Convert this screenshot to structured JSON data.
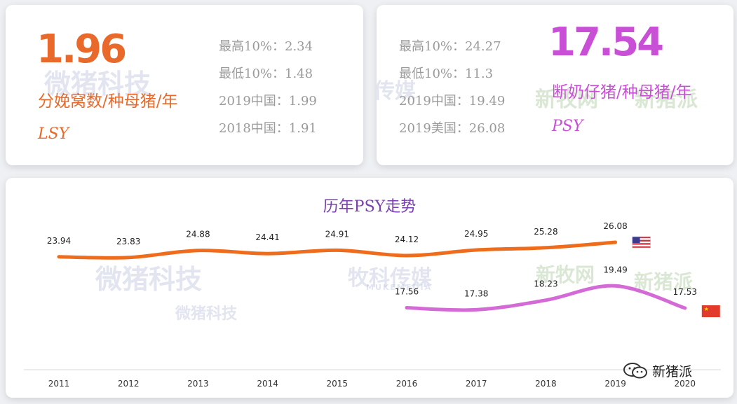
{
  "lsy_card": {
    "value": "1.96",
    "unit": "分娩窝数/种母猪/年",
    "abbr": "LSY",
    "stats": [
      "最高10%：2.34",
      "最低10%：1.48",
      "2019中国：1.99",
      "2018中国：1.91"
    ]
  },
  "psy_card": {
    "value": "17.54",
    "unit": "断奶仔猪/种母猪/年",
    "abbr": "PSY",
    "stats": [
      "最高10%：24.27",
      "最低10%：11.3",
      "2019中国：19.49",
      "2019美国：26.08"
    ]
  },
  "watermarks": {
    "weizhu": "微猪科技",
    "muke": "牧科传媒",
    "muke_en": "MUKEMEDIA",
    "xinmu": "新牧网",
    "xinzhu": "新猪派"
  },
  "brand": {
    "name": "新猪派"
  },
  "colors": {
    "lsy": "#e8692a",
    "psy": "#c94fd6",
    "title": "#7a3fb0"
  },
  "chart_data": {
    "type": "line",
    "title": "历年PSY走势",
    "x": [
      "2011",
      "2012",
      "2013",
      "2014",
      "2015",
      "2016",
      "2017",
      "2018",
      "2019",
      "2020"
    ],
    "series": [
      {
        "values": [
          23.94,
          23.83,
          24.88,
          24.41,
          24.91,
          24.12,
          24.95,
          25.28,
          26.08,
          null
        ],
        "color": "#ef6c1d",
        "flag": "us-flag"
      },
      {
        "values": [
          null,
          null,
          null,
          null,
          null,
          17.56,
          17.38,
          18.23,
          19.49,
          17.53
        ],
        "color": "#d46ad6",
        "flag": "china-flag"
      }
    ],
    "labels": [
      [
        "23.94",
        "23.83",
        "24.88",
        "24.41",
        "24.91",
        "24.12",
        "24.95",
        "25.28",
        "26.08",
        ""
      ],
      [
        "",
        "",
        "",
        "",
        "",
        "17.56",
        "17.38",
        "18.23",
        "19.49",
        "17.53"
      ]
    ],
    "grid": false,
    "legend": "none"
  }
}
